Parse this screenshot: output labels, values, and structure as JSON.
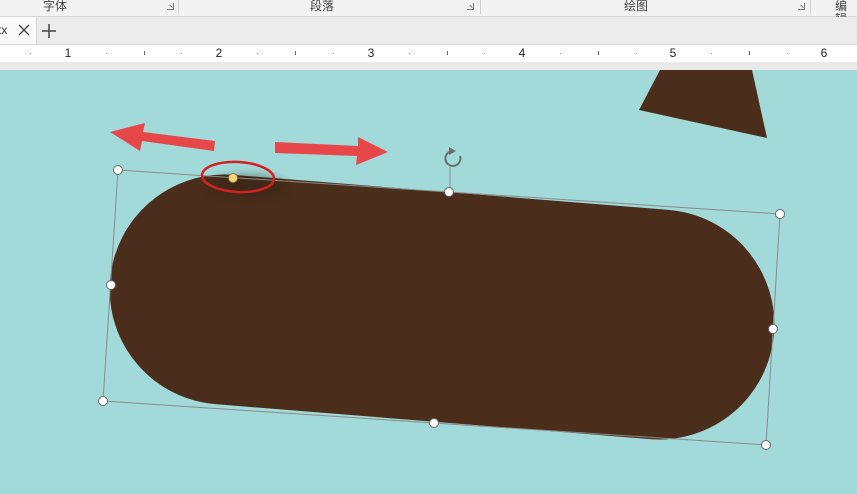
{
  "ribbon": {
    "groups": [
      {
        "label": "字体"
      },
      {
        "label": "段落"
      },
      {
        "label": "绘图"
      },
      {
        "label": "编辑"
      }
    ]
  },
  "tabs": {
    "items": [
      {
        "label": "tx"
      }
    ],
    "close_icon": "close-icon",
    "add_icon": "plus-icon"
  },
  "ruler": {
    "numbers": [
      "1",
      "2",
      "3",
      "4",
      "5",
      "6"
    ]
  },
  "canvas": {
    "background": "#a2d9d9",
    "shape_color": "#4a2e1b",
    "arrow_color": "#e8474a",
    "annotation_circle_color": "#d42020",
    "adjust_handle_color": "#f5d77a",
    "rotate_icon": "rotate-icon"
  }
}
